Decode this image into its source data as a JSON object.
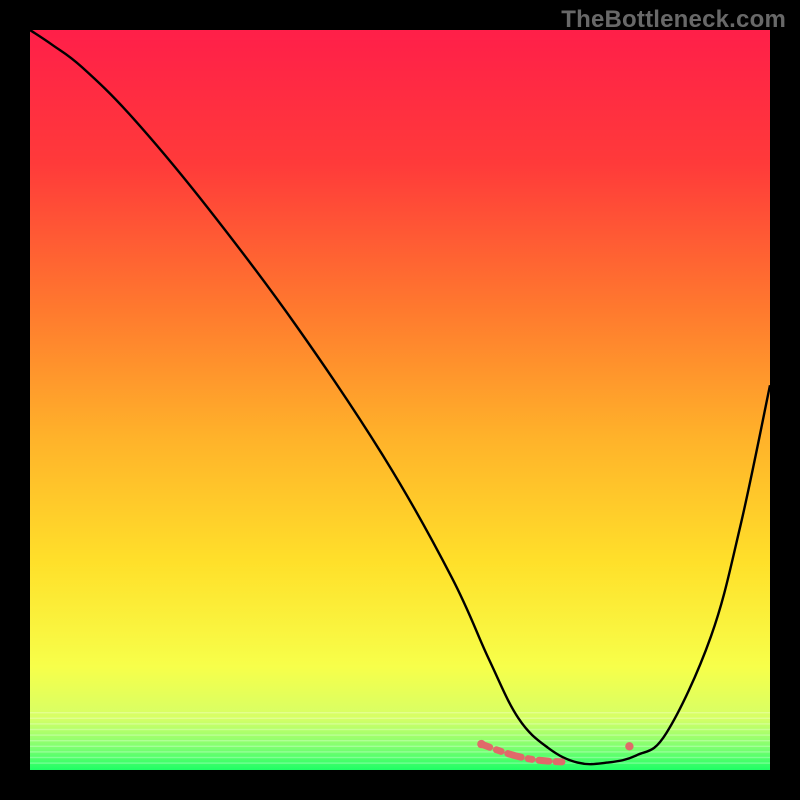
{
  "watermark": "TheBottleneck.com",
  "chart_data": {
    "type": "line",
    "title": "",
    "xlabel": "",
    "ylabel": "",
    "xlim": [
      0,
      100
    ],
    "ylim": [
      0,
      100
    ],
    "gradient_stops": [
      {
        "offset": 0,
        "color": "#ff1f49"
      },
      {
        "offset": 18,
        "color": "#ff3a3a"
      },
      {
        "offset": 38,
        "color": "#ff7a2e"
      },
      {
        "offset": 55,
        "color": "#ffb22a"
      },
      {
        "offset": 72,
        "color": "#ffe02a"
      },
      {
        "offset": 86,
        "color": "#f7ff4a"
      },
      {
        "offset": 93,
        "color": "#d6ff66"
      },
      {
        "offset": 97,
        "color": "#7dff70"
      },
      {
        "offset": 100,
        "color": "#1fff66"
      }
    ],
    "series": [
      {
        "name": "bottleneck-curve",
        "x": [
          0,
          3,
          7,
          14,
          24,
          36,
          48,
          57,
          62,
          66,
          70,
          74,
          78,
          82,
          86,
          92,
          96,
          100
        ],
        "y": [
          100,
          98,
          95,
          88,
          76,
          60,
          42,
          26,
          15,
          7,
          3,
          1,
          1,
          2,
          5,
          18,
          33,
          52
        ]
      }
    ],
    "optimum_band": {
      "name": "optimal-zone-marker",
      "x": [
        61,
        64,
        67,
        70,
        73,
        76,
        79,
        81
      ],
      "y": [
        3.5,
        2.4,
        1.6,
        1.2,
        1.1,
        1.3,
        1.9,
        3.2
      ],
      "color": "#e06a6a"
    }
  }
}
